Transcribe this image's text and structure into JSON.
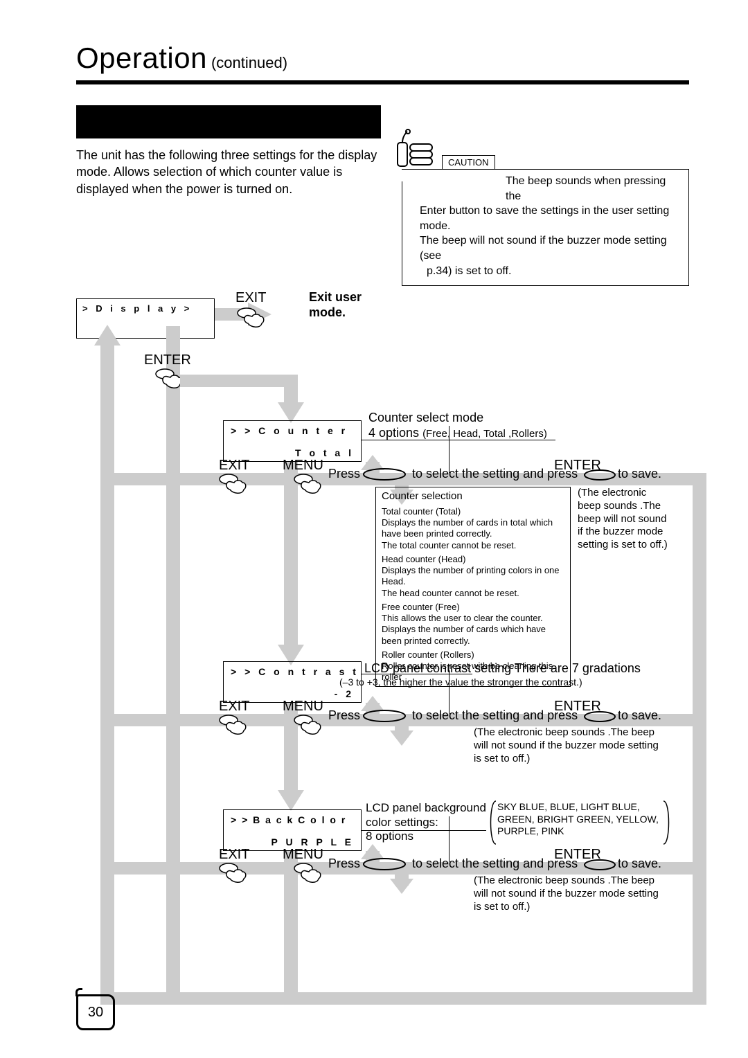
{
  "title": {
    "main": "Operation",
    "sub": "(continued)"
  },
  "intro": "The unit has the following three settings for the display mode.  Allows selection of which counter value is displayed when the power is turned on.",
  "caution": {
    "label": "CAUTION",
    "line1": "The beep sounds when pressing the",
    "line2": "Enter button to save the settings in the user setting mode.",
    "line3": "The beep will not sound if the buzzer mode setting (see",
    "line4": "p.34) is set to off."
  },
  "display_box": "> D i s p l a y >",
  "buttons": {
    "exit": "EXIT",
    "enter": "ENTER",
    "menu": "MENU",
    "exit_user": "Exit user\nmode."
  },
  "counter": {
    "lcd_title": "> > C o u n t e r",
    "lcd_value": "T o t a l",
    "mode_title": "Counter select mode",
    "mode_sub_pre": "4 options ",
    "mode_sub_small": "(Free, Head, Total ,Rollers)",
    "select_press": "Press",
    "select_mid": "to select the setting and press",
    "select_save": "to save.",
    "beep_note": "(The electronic beep sounds .The beep will not sound if the buzzer mode setting is set to off.)",
    "box_heading": "Counter selection",
    "box_total_h": "Total counter (Total)",
    "box_total_1": "Displays the number of cards in total which have been printed correctly.",
    "box_total_2": "The total counter cannot be reset.",
    "box_head_h": "Head counter (Head)",
    "box_head_1": "Displays the number of printing colors in one Head.",
    "box_head_2": "The head counter cannot be reset.",
    "box_free_h": "Free counter (Free)",
    "box_free_1": "This allows the user to clear the counter. Displays the number of cards which have been printed correctly.",
    "box_roller_h": "Roller counter (Rollers)",
    "box_roller_1": "Roller counter is reset with be cleaning  this roller"
  },
  "contrast": {
    "lcd_title": "> > C o n t r a s t",
    "lcd_value": "- 2",
    "mode_title": "LCD  panel contrast setting There are 7 gradations",
    "mode_sub": "(–3 to +3, the higher the value the stronger the contrast.)",
    "beep_note": "(The electronic beep sounds .The beep will not sound if the buzzer mode setting is set to off.)"
  },
  "backcolor": {
    "lcd_title": "> > B a c k   C o l o r",
    "lcd_value": "P U R P L E",
    "mode_title1": "LCD panel background",
    "mode_title2": "color settings:",
    "mode_title3": "8 options",
    "options": "SKY BLUE, BLUE, LIGHT BLUE, GREEN, BRIGHT GREEN, YELLOW, PURPLE, PINK",
    "beep_note": "(The electronic beep sounds .The beep will not sound if the buzzer mode setting is set to off.)"
  },
  "page_number": "30"
}
